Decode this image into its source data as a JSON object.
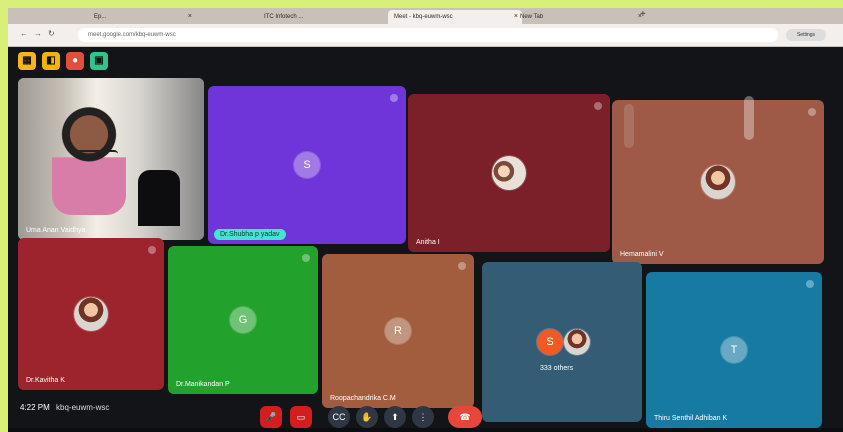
{
  "browser": {
    "tabs": [
      {
        "label": "Ep..."
      },
      {
        "label": "ITC Infotech ..."
      },
      {
        "label": "Meet - kbq-euwm-wsc"
      },
      {
        "label": "New Tab"
      }
    ],
    "url": "meet.google.com/kbq-euwm-wsc",
    "profile": "Settings",
    "tab_close": "×",
    "new_tab": "+",
    "nav_back": "←",
    "nav_forward": "→",
    "nav_reload": "↻"
  },
  "meet": {
    "toolbar_icons": [
      {
        "name": "notes",
        "symbol": "▦",
        "color": "#f6b51a"
      },
      {
        "name": "whiteboard",
        "symbol": "◧",
        "color": "#f4b400"
      },
      {
        "name": "recording",
        "symbol": "●",
        "color": "#e14f3d"
      },
      {
        "name": "activities",
        "symbol": "▣",
        "color": "#2fc58b"
      }
    ],
    "participants": [
      {
        "name": "Uma Anan Vaidhya",
        "avatar": "",
        "color": "#b8b4ae"
      },
      {
        "name": "Dr.Shubha p yadav",
        "avatar": "S",
        "color": "#6f35d8"
      },
      {
        "name": "Anitha I",
        "avatar": "",
        "color": "#7b2028"
      },
      {
        "name": "Hemamalini V",
        "avatar": "",
        "color": "#9e5a46"
      },
      {
        "name": "Dr.Kavitha K",
        "avatar": "",
        "color": "#9d232d"
      },
      {
        "name": "Dr.Manikandan P",
        "avatar": "G",
        "color": "#22a22d"
      },
      {
        "name": "Roopachandrika C.M",
        "avatar": "R",
        "color": "#a15d3e"
      },
      {
        "name": "333 others",
        "avatar": "S",
        "color": "#355c75"
      },
      {
        "name": "Thiru Senthil Adhiban K",
        "avatar": "T",
        "color": "#167aa2"
      }
    ],
    "footer": {
      "time": "4:22 PM",
      "meeting_code": "kbq-euwm-wsc"
    },
    "controls": [
      {
        "name": "mic",
        "symbol": "🎤"
      },
      {
        "name": "camera",
        "symbol": "▭"
      },
      {
        "name": "captions",
        "symbol": "CC"
      },
      {
        "name": "raise-hand",
        "symbol": "✋"
      },
      {
        "name": "present",
        "symbol": "⬆"
      },
      {
        "name": "more",
        "symbol": "⋮"
      },
      {
        "name": "leave",
        "symbol": "☎"
      }
    ]
  }
}
